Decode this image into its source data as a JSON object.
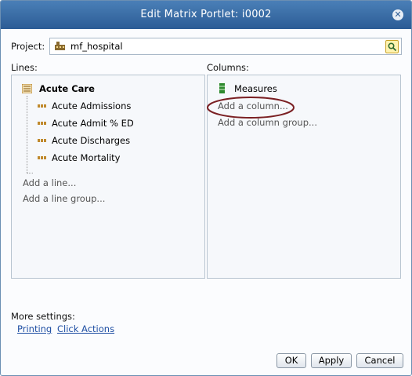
{
  "dialog": {
    "title": "Edit Matrix Portlet: i0002",
    "close_icon": "close-icon"
  },
  "project": {
    "label": "Project:",
    "value": "mf_hospital",
    "icon": "building-icon",
    "search_icon": "search-icon"
  },
  "lines": {
    "label": "Lines:",
    "group": {
      "name": "Acute Care",
      "icon": "list-icon"
    },
    "items": [
      {
        "label": "Acute Admissions",
        "icon": "measure-icon"
      },
      {
        "label": "Acute Admit % ED",
        "icon": "measure-icon"
      },
      {
        "label": "Acute Discharges",
        "icon": "measure-icon"
      },
      {
        "label": "Acute Mortality",
        "icon": "measure-icon"
      }
    ],
    "add_line": "Add a line...",
    "add_line_group": "Add a line group..."
  },
  "columns": {
    "label": "Columns:",
    "measures": {
      "label": "Measures",
      "icon": "measures-icon"
    },
    "add_column": "Add a column...",
    "add_column_group": "Add a column group...",
    "highlight_color": "#7a1f22"
  },
  "more_settings": {
    "label": "More settings:",
    "links": [
      "Printing",
      "Click Actions"
    ]
  },
  "buttons": {
    "ok": "OK",
    "apply": "Apply",
    "cancel": "Cancel"
  }
}
